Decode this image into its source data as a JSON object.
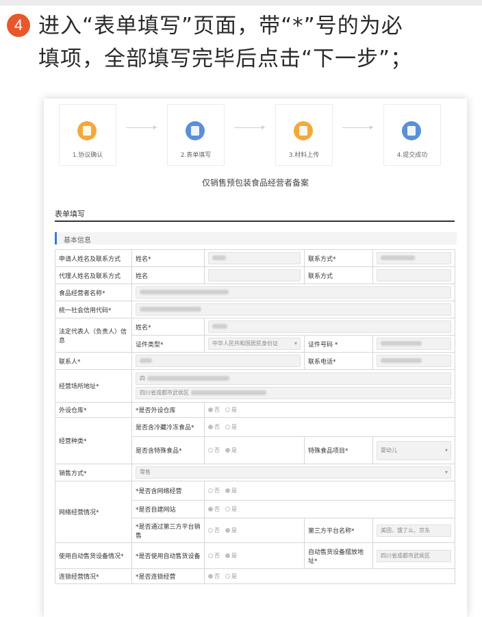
{
  "instruction": {
    "number": "4",
    "line1": "进入“表单填写”页面，带“*”号的为必",
    "line2": "填项，全部填写完毕后点击“下一步”；"
  },
  "steps": [
    {
      "label": "1.协议确认",
      "color": "#f2a93b"
    },
    {
      "label": "2.表单填写",
      "color": "#5b8fd8"
    },
    {
      "label": "3.材料上传",
      "color": "#f2a93b"
    },
    {
      "label": "4.提交成功",
      "color": "#5b8fd8"
    }
  ],
  "page_title": "仅销售预包装食品经营者备案",
  "section_title": "表单填写",
  "subsection_title": "基本信息",
  "form": {
    "applicant": "申请人姓名及联系方式",
    "agent": "代理人姓名及联系方式",
    "name_req": "姓名*",
    "name": "姓名",
    "contact_req": "联系方式*",
    "contact": "联系方式",
    "food_operator": "食品经营者名称*",
    "credit_code": "统一社会信用代码*",
    "legal_rep": "法定代表人（负责人）信息",
    "id_type": "证件类型*",
    "id_type_value": "中华人民共和国居民身份证",
    "id_number": "证件号码 *",
    "contact_person": "联系人*",
    "contact_phone": "联系电话*",
    "address": "经营场所地址*",
    "address_prefix_1": "四",
    "address_prefix_2": "四川省成都市武侯区",
    "warehouse": "外设仓库*",
    "warehouse_q": "*是否外设仓库",
    "no": "否",
    "yes": "是",
    "category": "经营种类*",
    "cold_q": "是否含冷藏冷冻食品*",
    "special_q": "是否含特殊食品*",
    "special_item": "特殊食品项目*",
    "special_item_value": "婴幼儿",
    "sale_mode": "销售方式*",
    "sale_mode_value": "零售",
    "online": "网络经营情况*",
    "online_q": "*是否含网络经营",
    "own_site_q": "*是否自建网站",
    "third_party_q": "*是否通过第三方平台销售",
    "third_party_name": "第三方平台名称*",
    "third_party_value": "美团、饿了么、京东",
    "vending": "使用自动售货设备情况*",
    "vending_q": "*是否使用自动售货设备",
    "vending_addr": "自动售货设备摆放地址*",
    "vending_addr_value": "四川省成都市武侯区",
    "chain": "连锁经营情况*",
    "chain_q": "*是否连锁经营"
  }
}
